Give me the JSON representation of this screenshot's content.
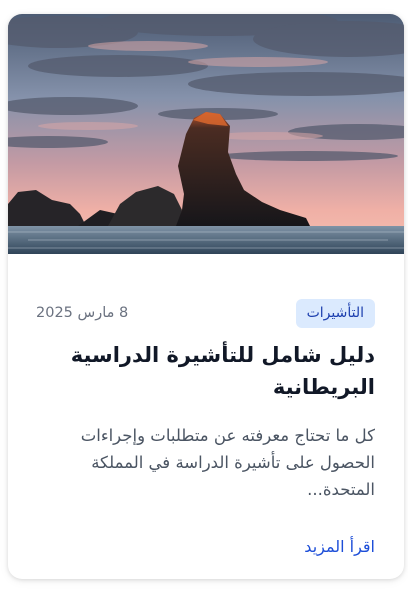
{
  "article": {
    "image_alt": "",
    "category": "التأشيرات",
    "date": "8 مارس 2025",
    "title": "دليل شامل للتأشيرة الدراسية البريطانية",
    "excerpt": "كل ما تحتاج معرفته عن متطلبات وإجراءات الحصول على تأشيرة الدراسة في المملكة المتحدة...",
    "read_more": "اقرأ المزيد"
  },
  "colors": {
    "badge_bg": "#dbeafe",
    "badge_text": "#1e40af",
    "link": "#1d4ed8",
    "title": "#111827",
    "body_text": "#4b5563",
    "meta_text": "#6b7280"
  }
}
